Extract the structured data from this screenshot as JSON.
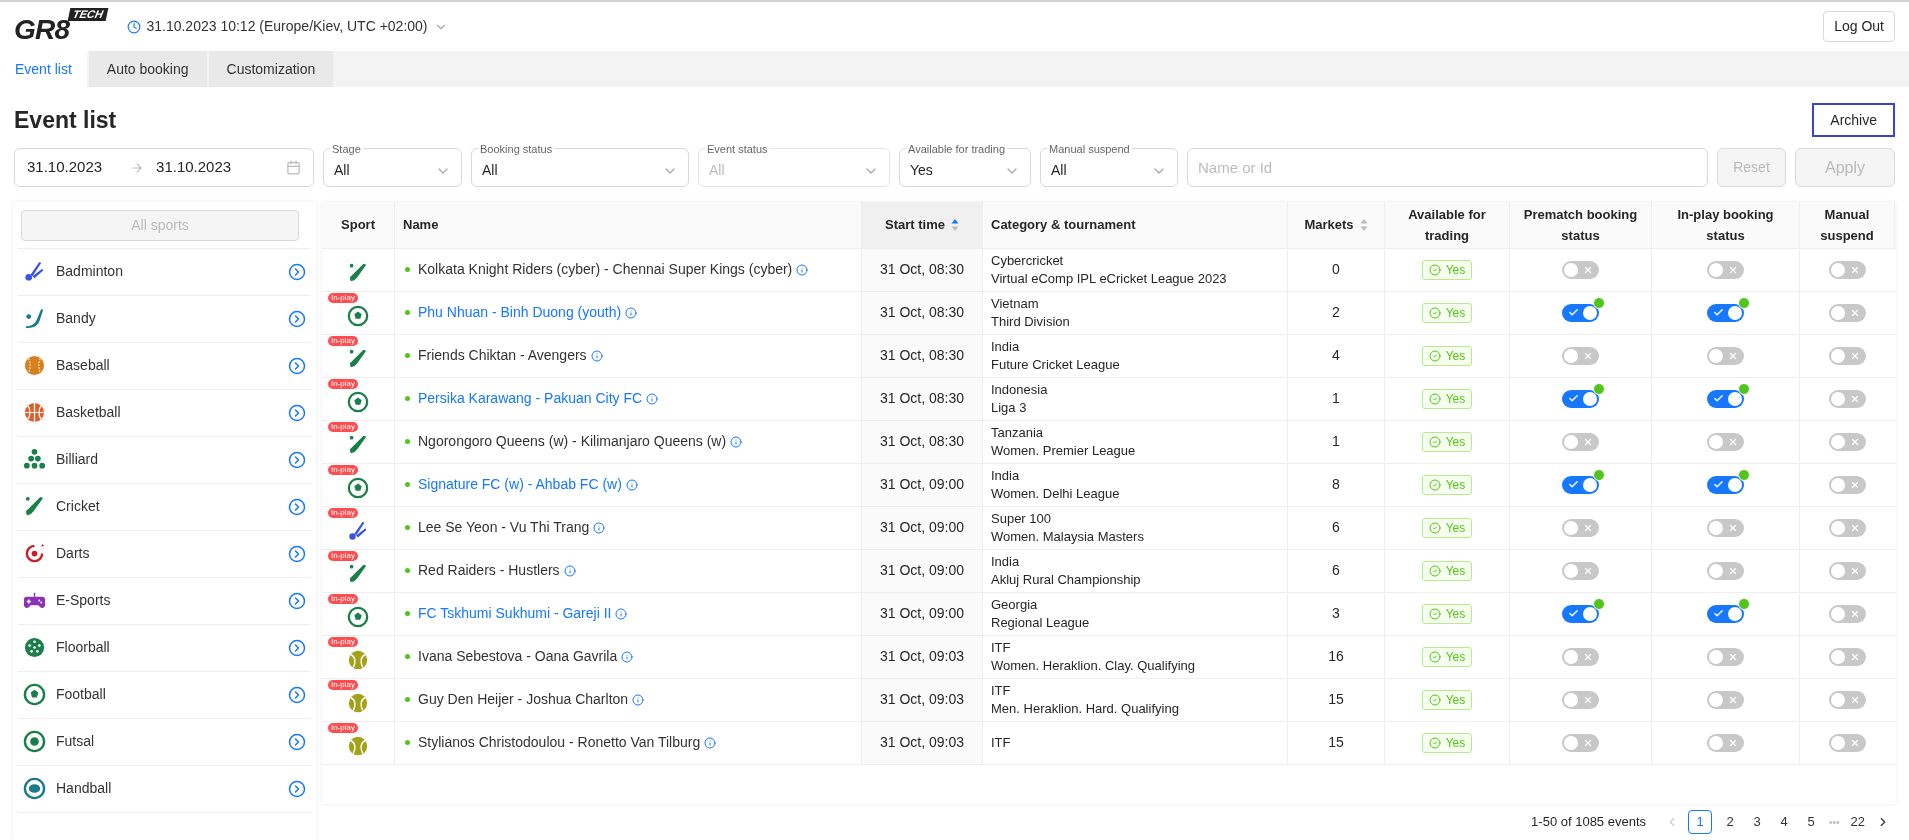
{
  "header": {
    "logo": {
      "main": "GR8",
      "sup": "TECH"
    },
    "datetime": "31.10.2023 10:12 (Europe/Kiev, UTC +02:00)",
    "logout": "Log Out"
  },
  "tabs": [
    {
      "label": "Event list",
      "selected": true
    },
    {
      "label": "Auto booking",
      "selected": false
    },
    {
      "label": "Customization",
      "selected": false
    }
  ],
  "title": "Event list",
  "archive_button": "Archive",
  "filters": {
    "date_from": "31.10.2023",
    "date_to": "31.10.2023",
    "selects": [
      {
        "label": "Stage",
        "value": "All",
        "disabled": false
      },
      {
        "label": "Booking status",
        "value": "All",
        "disabled": false
      },
      {
        "label": "Event status",
        "value": "All",
        "disabled": true
      },
      {
        "label": "Available for trading",
        "value": "Yes",
        "disabled": false
      },
      {
        "label": "Manual suspend",
        "value": "All",
        "disabled": false
      }
    ],
    "search_placeholder": "Name or Id",
    "reset": "Reset",
    "apply": "Apply"
  },
  "sidebar": {
    "all_sports": "All sports",
    "items": [
      {
        "label": "Badminton",
        "kind": "badminton"
      },
      {
        "label": "Bandy",
        "kind": "bandy"
      },
      {
        "label": "Baseball",
        "kind": "baseball"
      },
      {
        "label": "Basketball",
        "kind": "basketball"
      },
      {
        "label": "Billiard",
        "kind": "billiard"
      },
      {
        "label": "Cricket",
        "kind": "cricket"
      },
      {
        "label": "Darts",
        "kind": "darts"
      },
      {
        "label": "E-Sports",
        "kind": "esports"
      },
      {
        "label": "Floorball",
        "kind": "floorball"
      },
      {
        "label": "Football",
        "kind": "football"
      },
      {
        "label": "Futsal",
        "kind": "futsal"
      },
      {
        "label": "Handball",
        "kind": "handball"
      }
    ]
  },
  "table": {
    "columns": [
      {
        "label": "Sport",
        "sortable": false,
        "sorted": false
      },
      {
        "label": "Name",
        "sortable": false,
        "sorted": false
      },
      {
        "label": "Start time",
        "sortable": true,
        "sorted": true
      },
      {
        "label": "Category & tournament",
        "sortable": false,
        "sorted": false
      },
      {
        "label": "Markets",
        "sortable": true,
        "sorted": false
      },
      {
        "label": "Available for trading",
        "sortable": false,
        "sorted": false
      },
      {
        "label": "Prematch booking status",
        "sortable": false,
        "sorted": false
      },
      {
        "label": "In-play booking status",
        "sortable": false,
        "sorted": false
      },
      {
        "label": "Manual suspend",
        "sortable": false,
        "sorted": false
      }
    ],
    "rows": [
      {
        "kind": "cricket",
        "name": "Kolkata Knight Riders (cyber) - Chennai Super Kings (cyber)",
        "linked": false,
        "time": "31 Oct, 08:30",
        "category": "Cybercricket",
        "tournament": "Virtual eComp IPL eCricket League 2023",
        "markets": "0",
        "available": "Yes",
        "prematch": {
          "on": false,
          "auto": false
        },
        "inplay": {
          "on": false,
          "auto": false
        },
        "suspend": false
      },
      {
        "kind": "football",
        "badge": "In-play",
        "name": "Phu Nhuan - Binh Duong (youth)",
        "linked": true,
        "time": "31 Oct, 08:30",
        "category": "Vietnam",
        "tournament": "Third Division",
        "markets": "2",
        "available": "Yes",
        "prematch": {
          "on": true,
          "auto": true
        },
        "inplay": {
          "on": true,
          "auto": true
        },
        "suspend": false
      },
      {
        "kind": "cricket",
        "badge": "In-play",
        "name": "Friends Chiktan - Avengers",
        "linked": false,
        "time": "31 Oct, 08:30",
        "category": "India",
        "tournament": "Future Cricket League",
        "markets": "4",
        "available": "Yes",
        "prematch": {
          "on": false,
          "auto": false
        },
        "inplay": {
          "on": false,
          "auto": false
        },
        "suspend": false
      },
      {
        "kind": "football",
        "badge": "In-play",
        "name": "Persika Karawang - Pakuan City FC",
        "linked": true,
        "time": "31 Oct, 08:30",
        "category": "Indonesia",
        "tournament": "Liga 3",
        "markets": "1",
        "available": "Yes",
        "prematch": {
          "on": true,
          "auto": true
        },
        "inplay": {
          "on": true,
          "auto": true
        },
        "suspend": false
      },
      {
        "kind": "cricket",
        "badge": "In-play",
        "name": "Ngorongoro Queens (w) - Kilimanjaro Queens (w)",
        "linked": false,
        "time": "31 Oct, 08:30",
        "category": "Tanzania",
        "tournament": "Women. Premier League",
        "markets": "1",
        "available": "Yes",
        "prematch": {
          "on": false,
          "auto": false
        },
        "inplay": {
          "on": false,
          "auto": false
        },
        "suspend": false
      },
      {
        "kind": "football",
        "badge": "In-play",
        "name": "Signature FC (w) - Ahbab FC (w)",
        "linked": true,
        "time": "31 Oct, 09:00",
        "category": "India",
        "tournament": "Women. Delhi League",
        "markets": "8",
        "available": "Yes",
        "prematch": {
          "on": true,
          "auto": true
        },
        "inplay": {
          "on": true,
          "auto": true
        },
        "suspend": false
      },
      {
        "kind": "badminton",
        "badge": "In-play",
        "name": "Lee Se Yeon - Vu Thi Trang",
        "linked": false,
        "time": "31 Oct, 09:00",
        "category": "Super 100",
        "tournament": "Women. Malaysia Masters",
        "markets": "6",
        "available": "Yes",
        "prematch": {
          "on": false,
          "auto": false
        },
        "inplay": {
          "on": false,
          "auto": false
        },
        "suspend": false
      },
      {
        "kind": "cricket",
        "badge": "In-play",
        "name": "Red Raiders - Hustlers",
        "linked": false,
        "time": "31 Oct, 09:00",
        "category": "India",
        "tournament": "Akluj Rural Championship",
        "markets": "6",
        "available": "Yes",
        "prematch": {
          "on": false,
          "auto": false
        },
        "inplay": {
          "on": false,
          "auto": false
        },
        "suspend": false
      },
      {
        "kind": "football",
        "badge": "In-play",
        "name": "FC Tskhumi Sukhumi - Gareji II",
        "linked": true,
        "time": "31 Oct, 09:00",
        "category": "Georgia",
        "tournament": "Regional League",
        "markets": "3",
        "available": "Yes",
        "prematch": {
          "on": true,
          "auto": true
        },
        "inplay": {
          "on": true,
          "auto": true
        },
        "suspend": false
      },
      {
        "kind": "tennis",
        "badge": "In-play",
        "name": "Ivana Sebestova - Oana Gavrila",
        "linked": false,
        "time": "31 Oct, 09:03",
        "category": "ITF",
        "tournament": "Women. Heraklion. Clay. Qualifying",
        "markets": "16",
        "available": "Yes",
        "prematch": {
          "on": false,
          "auto": false
        },
        "inplay": {
          "on": false,
          "auto": false
        },
        "suspend": false
      },
      {
        "kind": "tennis",
        "badge": "In-play",
        "name": "Guy Den Heijer - Joshua Charlton",
        "linked": false,
        "time": "31 Oct, 09:03",
        "category": "ITF",
        "tournament": "Men. Heraklion. Hard. Qualifying",
        "markets": "15",
        "available": "Yes",
        "prematch": {
          "on": false,
          "auto": false
        },
        "inplay": {
          "on": false,
          "auto": false
        },
        "suspend": false
      },
      {
        "kind": "tennis",
        "badge": "In-play",
        "name": "Stylianos Christodoulou - Ronetto Van Tilburg",
        "linked": false,
        "time": "31 Oct, 09:03",
        "category": "ITF",
        "markets": "15",
        "available": "Yes",
        "prematch": {
          "on": false,
          "auto": false
        },
        "inplay": {
          "on": false,
          "auto": false
        },
        "suspend": false
      }
    ]
  },
  "pagination": {
    "summary": "1-50 of 1085 events",
    "prev_disabled": true,
    "pages": [
      {
        "label": "1",
        "selected": true
      },
      {
        "label": "2",
        "selected": false
      },
      {
        "label": "3",
        "selected": false
      },
      {
        "label": "4",
        "selected": false
      },
      {
        "label": "5",
        "selected": false
      },
      {
        "label": "•••",
        "kind": "ellipsis"
      },
      {
        "label": "22",
        "selected": false
      }
    ]
  }
}
